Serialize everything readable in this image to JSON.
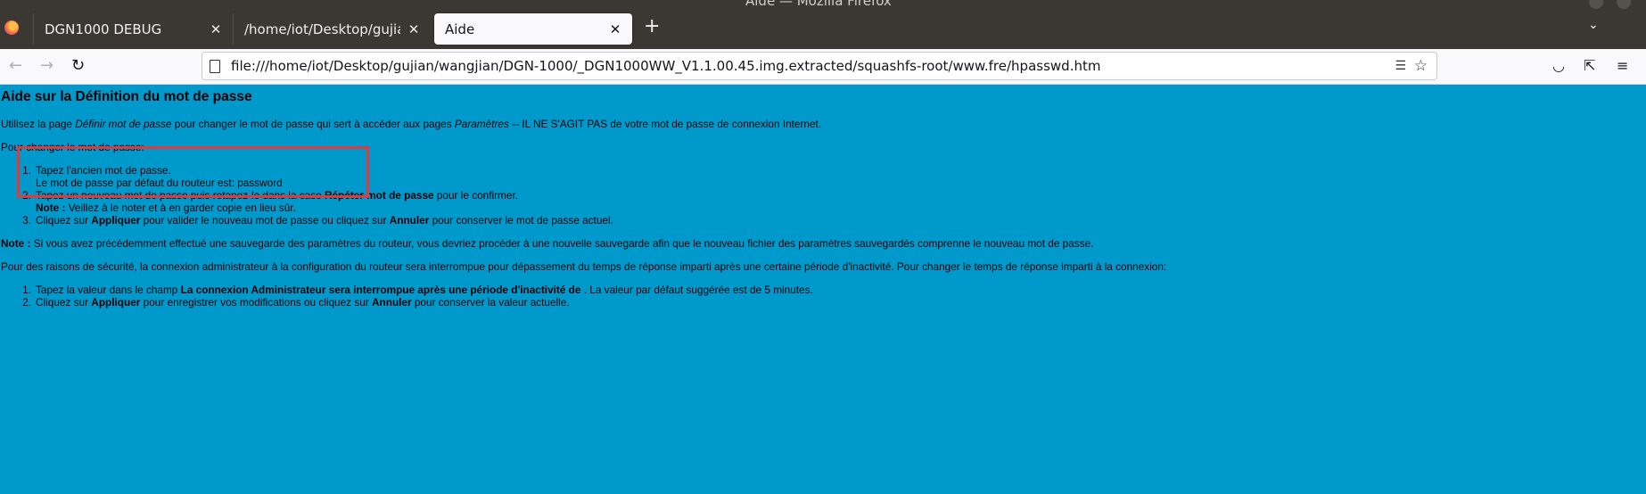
{
  "window": {
    "title": "Aide — Mozilla Firefox"
  },
  "tabs": [
    {
      "label": "DGN1000 DEBUG",
      "active": false
    },
    {
      "label": "/home/iot/Desktop/gujian/w",
      "active": false
    },
    {
      "label": "Aide",
      "active": true
    }
  ],
  "tab_close_glyph": "✕",
  "newtab_glyph": "+",
  "tablist_glyph": "⌄",
  "nav": {
    "back_glyph": "←",
    "forward_glyph": "→",
    "reload_glyph": "↻",
    "url": "file:///home/iot/Desktop/gujian/wangjian/DGN-1000/_DGN1000WW_V1.1.00.45.img.extracted/squashfs-root/www.fre/hpasswd.htm",
    "reader_glyph": "☰",
    "star_glyph": "☆",
    "pocket_glyph": "◡",
    "extensions_glyph": "⇱",
    "menu_glyph": "≡"
  },
  "page": {
    "heading": "Aide sur la Définition du mot de passe",
    "intro": {
      "t1": "Utilisez la page ",
      "i1": "Définir mot de passe",
      "t2": " pour changer le mot de passe qui sert à accéder aux pages ",
      "i2": "Paramètres",
      "t3": " -- IL NE S'AGIT PAS de votre mot de passe de connexion Internet."
    },
    "change_intro": "Pour changer le mot de passe:",
    "steps": {
      "s1_num": "1.",
      "s1": "Tapez l'ancien mot de passe.",
      "s1_default": "Le mot de passe par défaut du routeur est:  password",
      "s2_num": "2.",
      "s2_a": "Tapez un nouveau mot de passe puis retapez-le dans la case ",
      "s2_b": "Répéter mot de passe",
      "s2_c": " pour le confirmer.",
      "s2_note_label": "Note :",
      "s2_note": " Veillez à le noter et à en garder copie en lieu sûr.",
      "s3_num": "3.",
      "s3_a": "Cliquez sur ",
      "s3_b": "Appliquer",
      "s3_c": " pour valider le nouveau mot de passe ou cliquez sur ",
      "s3_d": "Annuler",
      "s3_e": " pour conserver le mot de passe actuel."
    },
    "note": {
      "label": "Note :",
      "text": " Si vous avez précédemment effectué une sauvegarde des paramètres du routeur, vous devriez procéder à une nouvelle sauvegarde afin que le nouveau fichier des paramètres sauvegardés comprenne le nouveau mot de passe."
    },
    "security": "Pour des raisons de sécurité, la connexion administrateur à la configuration du routeur sera interrompue pour dépassement du temps de réponse imparti après une certaine période d'inactivité. Pour changer le temps de réponse imparti à la connexion:",
    "timeout_steps": {
      "t1_num": "1.",
      "t1_a": "Tapez la valeur dans le champ ",
      "t1_b": "La connexion Administrateur sera interrompue après une période d'inactivité de",
      "t1_c": " . La valeur par défaut suggérée est de 5 minutes.",
      "t2_num": "2.",
      "t2_a": "Cliquez sur ",
      "t2_b": "Appliquer",
      "t2_c": " pour enregistrer vos modifications ou cliquez sur ",
      "t2_d": "Annuler",
      "t2_e": " pour conserver la valeur actuelle."
    }
  },
  "colors": {
    "page_bg": "#0099cc",
    "highlight_box": "#e23a3a",
    "tabstrip": "#3b3834"
  }
}
